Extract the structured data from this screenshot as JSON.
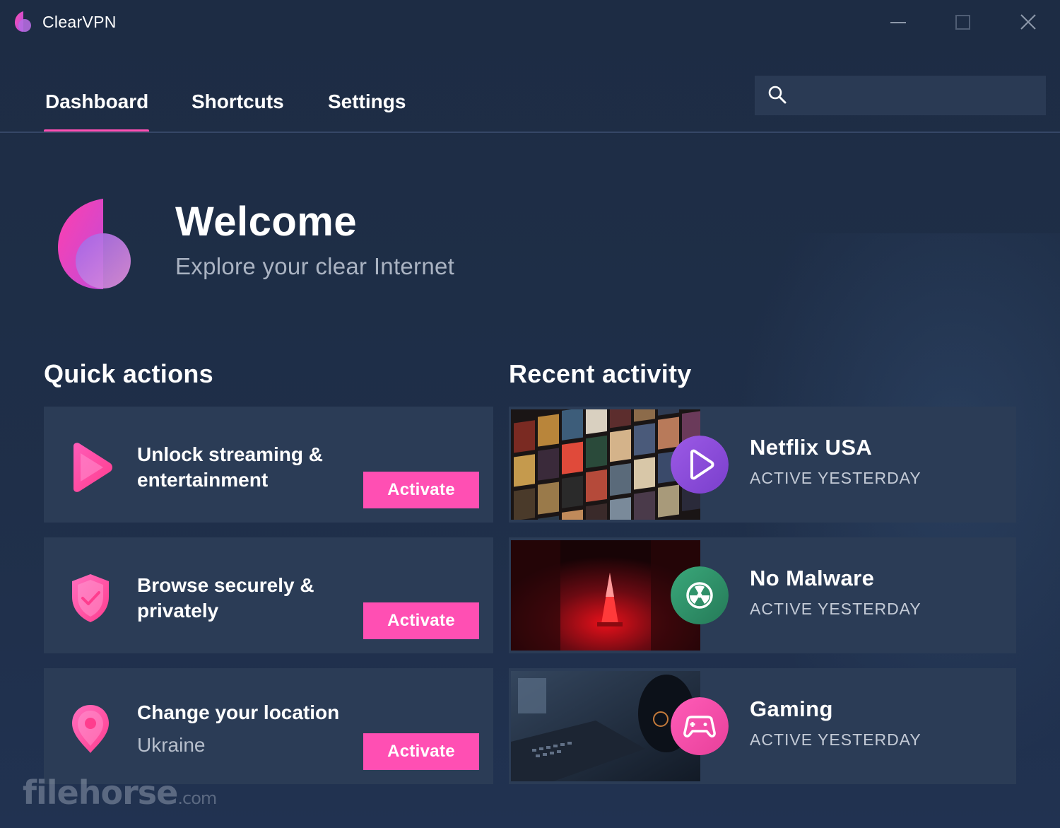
{
  "app": {
    "title": "ClearVPN",
    "accent_color": "#ff4fb3",
    "background_color": "#1e2d45"
  },
  "window_controls": {
    "minimize_icon": "minimize-icon",
    "maximize_icon": "maximize-icon",
    "close_icon": "close-icon"
  },
  "nav": {
    "tabs": [
      {
        "label": "Dashboard",
        "active": true
      },
      {
        "label": "Shortcuts",
        "active": false
      },
      {
        "label": "Settings",
        "active": false
      }
    ]
  },
  "search": {
    "icon": "search-icon",
    "value": "",
    "placeholder": ""
  },
  "welcome": {
    "title": "Welcome",
    "subtitle": "Explore your clear Internet"
  },
  "quick_actions": {
    "title": "Quick actions",
    "items": [
      {
        "icon": "play-icon",
        "label": "Unlock streaming & entertainment",
        "sublabel": "",
        "button": "Activate"
      },
      {
        "icon": "shield-check-icon",
        "label": "Browse securely & privately",
        "sublabel": "",
        "button": "Activate"
      },
      {
        "icon": "location-pin-icon",
        "label": "Change your location",
        "sublabel": "Ukraine",
        "button": "Activate"
      }
    ]
  },
  "recent_activity": {
    "title": "Recent activity",
    "items": [
      {
        "name": "Netflix USA",
        "status": "ACTIVE YESTERDAY",
        "badge_icon": "play-icon",
        "badge_color": "#8a4fd8"
      },
      {
        "name": "No Malware",
        "status": "ACTIVE YESTERDAY",
        "badge_icon": "radiation-icon",
        "badge_color": "#2f9a6e"
      },
      {
        "name": "Gaming",
        "status": "ACTIVE YESTERDAY",
        "badge_icon": "gamepad-icon",
        "badge_color": "#f04ca8"
      }
    ]
  },
  "watermark": {
    "text": "filehorse",
    "suffix": ".com"
  }
}
